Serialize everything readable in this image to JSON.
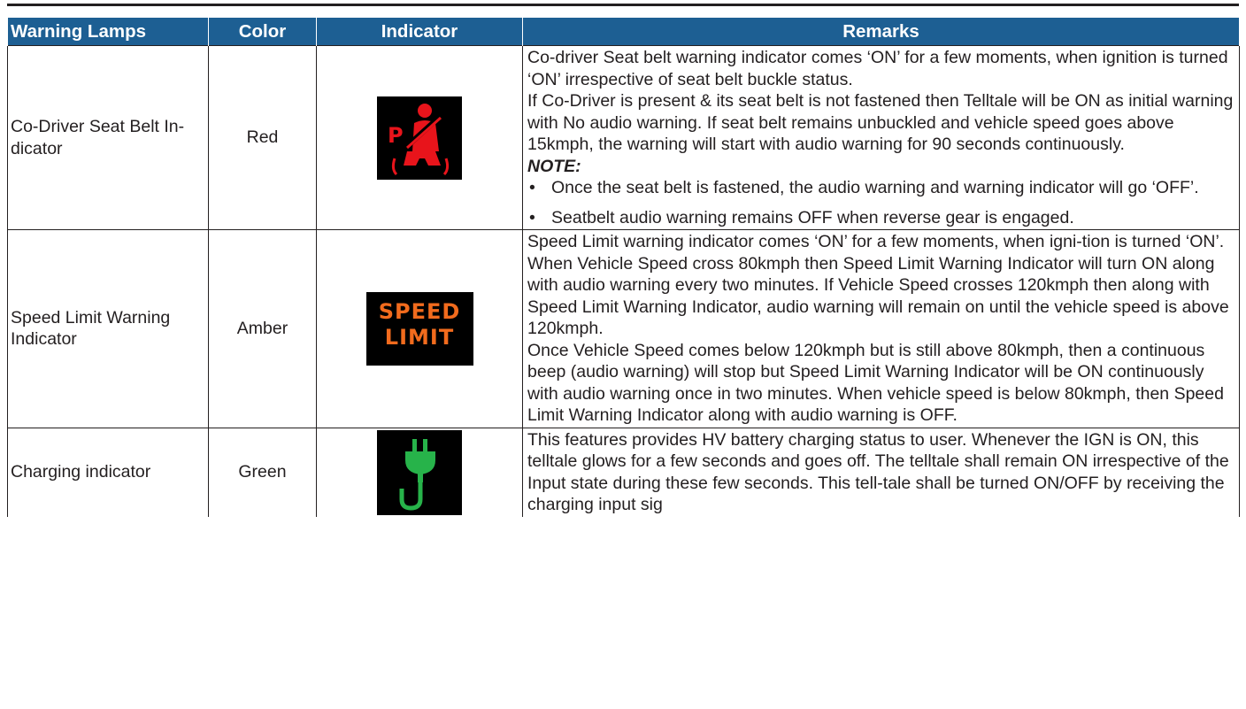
{
  "headers": {
    "warning_lamps": "Warning Lamps",
    "color": "Color",
    "indicator": "Indicator",
    "remarks": "Remarks"
  },
  "rows": [
    {
      "lamp": "Co-Driver Seat Belt In-dicator",
      "color": "Red",
      "icon": "passenger-seat-belt-icon",
      "remarks": [
        "Co-driver Seat belt warning indicator comes ‘ON’ for a few moments, when ignition is turned ‘ON’ irrespective of seat belt buckle status.",
        "If Co-Driver is present & its seat belt is not fastened then Telltale will be ON as initial warning with No audio warning. If seat belt remains unbuckled and vehicle speed goes above 15kmph, the warning will start with audio warning for 90 seconds continuously."
      ],
      "note_title": "NOTE:",
      "notes": [
        "Once the seat belt is fastened, the audio warning and warning indicator will go ‘OFF’.",
        "Seatbelt audio warning remains OFF when reverse gear is engaged."
      ]
    },
    {
      "lamp": "Speed Limit Warning Indicator",
      "color": "Amber",
      "icon": "speed-limit-icon",
      "icon_text_1": "SPEED",
      "icon_text_2": "LIMIT",
      "remarks": [
        "Speed Limit warning indicator comes ‘ON’ for a few moments, when igni-tion is turned ‘ON’. When Vehicle Speed cross 80kmph then Speed Limit Warning Indicator will turn ON along with audio warning every two minutes. If Vehicle Speed crosses 120kmph then along with Speed Limit Warning Indicator, audio warning will remain on until the vehicle speed is above 120kmph.",
        "Once Vehicle Speed comes below 120kmph but is still above 80kmph, then a continuous beep (audio warning) will stop but Speed Limit Warning Indicator will be ON continuously with audio warning once in two minutes. When vehicle speed is below 80kmph, then Speed Limit Warning Indicator along with audio warning is OFF."
      ]
    },
    {
      "lamp": "Charging indicator",
      "color": "Green",
      "icon": "charging-plug-icon",
      "remarks": [
        "This features provides HV battery charging status to user. Whenever the IGN is ON, this telltale glows for a few seconds and goes off.  The telltale shall remain ON irrespective of the Input state during these few seconds. This tell-tale shall be turned ON/OFF by receiving the charging input sig"
      ]
    }
  ],
  "colors": {
    "header_bg": "#1d5f93",
    "red_icon": "#e8141b",
    "amber_icon": "#f26b1d",
    "green_icon": "#27b34a"
  }
}
